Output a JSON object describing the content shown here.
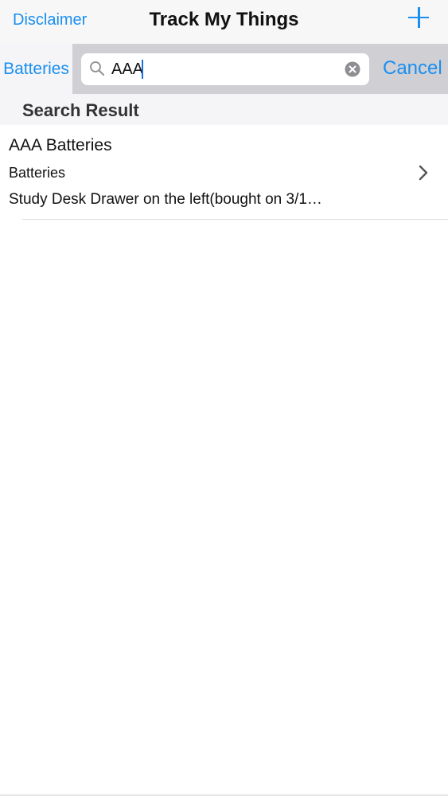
{
  "navbar": {
    "left_label": "Disclaimer",
    "title": "Track My Things",
    "add_icon": "plus-icon"
  },
  "search": {
    "scope_label": "Batteries",
    "value": "AAA",
    "cancel_label": "Cancel",
    "search_icon": "magnifier-icon",
    "clear_icon": "clear-circle-x-icon"
  },
  "results": {
    "section_title": "Search Result",
    "items": [
      {
        "title": "AAA Batteries",
        "category": "Batteries",
        "location": "Study Desk Drawer on the left(bought on 3/1…",
        "chevron_icon": "chevron-right-icon"
      }
    ]
  },
  "colors": {
    "accent": "#1a8ff0",
    "nav_bg": "#f7f7f7",
    "search_bg": "#cfcfd4",
    "section_bg": "#f5f5f7"
  }
}
